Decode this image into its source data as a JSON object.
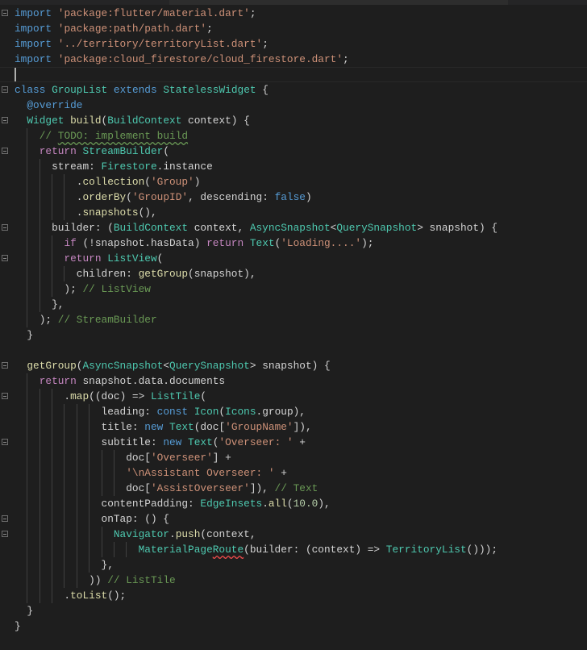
{
  "editor": {
    "language": "dart",
    "colors": {
      "background": "#1e1e1e",
      "keyword": "#569cd6",
      "control": "#c586c0",
      "string": "#ce9178",
      "type": "#4ec9b0",
      "function": "#dcdcaa",
      "comment": "#6a9955"
    },
    "lines": [
      {
        "fold": true,
        "tokens": [
          [
            "import",
            "kw"
          ],
          [
            " ",
            ""
          ],
          [
            "'package:flutter/material.dart'",
            "str"
          ],
          [
            ";",
            ""
          ]
        ]
      },
      {
        "tokens": [
          [
            "import",
            "kw"
          ],
          [
            " ",
            ""
          ],
          [
            "'package:path/path.dart'",
            "str"
          ],
          [
            ";",
            ""
          ]
        ]
      },
      {
        "tokens": [
          [
            "import",
            "kw"
          ],
          [
            " ",
            ""
          ],
          [
            "'../territory/territoryList.dart'",
            "str"
          ],
          [
            ";",
            ""
          ]
        ]
      },
      {
        "tokens": [
          [
            "import",
            "kw"
          ],
          [
            " ",
            ""
          ],
          [
            "'package:cloud_firestore/cloud_firestore.dart'",
            "str"
          ],
          [
            ";",
            ""
          ]
        ]
      },
      {
        "cursor": true,
        "tokens": []
      },
      {
        "fold": true,
        "tokens": [
          [
            "class",
            "kw"
          ],
          [
            " ",
            ""
          ],
          [
            "GroupList",
            "type"
          ],
          [
            " ",
            ""
          ],
          [
            "extends",
            "kw"
          ],
          [
            " ",
            ""
          ],
          [
            "StatelessWidget",
            "type"
          ],
          [
            " {",
            ""
          ]
        ]
      },
      {
        "tokens": [
          [
            "  ",
            ""
          ],
          [
            "@override",
            "meta"
          ]
        ]
      },
      {
        "fold": true,
        "tokens": [
          [
            "  ",
            ""
          ],
          [
            "Widget",
            "type"
          ],
          [
            " ",
            ""
          ],
          [
            "build",
            "fn"
          ],
          [
            "(",
            ""
          ],
          [
            "BuildContext",
            "type"
          ],
          [
            " context) {",
            ""
          ]
        ]
      },
      {
        "tokens": [
          [
            "    ",
            ""
          ],
          [
            "// ",
            "cm"
          ],
          [
            "TODO: implement build",
            "cm sq-g"
          ]
        ]
      },
      {
        "fold": true,
        "tokens": [
          [
            "    ",
            ""
          ],
          [
            "return",
            "ctrl"
          ],
          [
            " ",
            ""
          ],
          [
            "StreamBuilder",
            "type"
          ],
          [
            "(",
            ""
          ]
        ]
      },
      {
        "tokens": [
          [
            "      stream: ",
            ""
          ],
          [
            "Firestore",
            "type"
          ],
          [
            ".instance",
            ""
          ]
        ]
      },
      {
        "tokens": [
          [
            "          .",
            ""
          ],
          [
            "collection",
            "fn"
          ],
          [
            "(",
            ""
          ],
          [
            "'Group'",
            "str"
          ],
          [
            ")",
            ""
          ]
        ]
      },
      {
        "tokens": [
          [
            "          .",
            ""
          ],
          [
            "orderBy",
            "fn"
          ],
          [
            "(",
            ""
          ],
          [
            "'GroupID'",
            "str"
          ],
          [
            ", descending: ",
            ""
          ],
          [
            "false",
            "kw"
          ],
          [
            ")",
            ""
          ]
        ]
      },
      {
        "tokens": [
          [
            "          .",
            ""
          ],
          [
            "snapshots",
            "fn"
          ],
          [
            "(),",
            ""
          ]
        ]
      },
      {
        "fold": true,
        "tokens": [
          [
            "      builder: (",
            ""
          ],
          [
            "BuildContext",
            "type"
          ],
          [
            " context, ",
            ""
          ],
          [
            "AsyncSnapshot",
            "type"
          ],
          [
            "<",
            ""
          ],
          [
            "QuerySnapshot",
            "type"
          ],
          [
            "> snapshot) {",
            ""
          ]
        ]
      },
      {
        "tokens": [
          [
            "        ",
            ""
          ],
          [
            "if",
            "ctrl"
          ],
          [
            " (!snapshot.hasData) ",
            ""
          ],
          [
            "return",
            "ctrl"
          ],
          [
            " ",
            ""
          ],
          [
            "Text",
            "type"
          ],
          [
            "(",
            ""
          ],
          [
            "'Loading....'",
            "str"
          ],
          [
            ");",
            ""
          ]
        ]
      },
      {
        "fold": true,
        "tokens": [
          [
            "        ",
            ""
          ],
          [
            "return",
            "ctrl"
          ],
          [
            " ",
            ""
          ],
          [
            "ListView",
            "type"
          ],
          [
            "(",
            ""
          ]
        ]
      },
      {
        "tokens": [
          [
            "          children: ",
            ""
          ],
          [
            "getGroup",
            "fn"
          ],
          [
            "(snapshot),",
            ""
          ]
        ]
      },
      {
        "tokens": [
          [
            "        ); ",
            ""
          ],
          [
            "// ListView",
            "cm"
          ]
        ]
      },
      {
        "tokens": [
          [
            "      },",
            ""
          ]
        ]
      },
      {
        "tokens": [
          [
            "    ); ",
            ""
          ],
          [
            "// StreamBuilder",
            "cm"
          ]
        ]
      },
      {
        "tokens": [
          [
            "  }",
            ""
          ]
        ]
      },
      {
        "tokens": []
      },
      {
        "fold": true,
        "tokens": [
          [
            "  ",
            ""
          ],
          [
            "getGroup",
            "fn"
          ],
          [
            "(",
            ""
          ],
          [
            "AsyncSnapshot",
            "type"
          ],
          [
            "<",
            ""
          ],
          [
            "QuerySnapshot",
            "type"
          ],
          [
            "> snapshot) {",
            ""
          ]
        ]
      },
      {
        "tokens": [
          [
            "    ",
            ""
          ],
          [
            "return",
            "ctrl"
          ],
          [
            " snapshot.data.documents",
            ""
          ]
        ]
      },
      {
        "fold": true,
        "tokens": [
          [
            "        .",
            ""
          ],
          [
            "map",
            "fn"
          ],
          [
            "((doc) => ",
            ""
          ],
          [
            "ListTile",
            "type"
          ],
          [
            "(",
            ""
          ]
        ]
      },
      {
        "tokens": [
          [
            "              leading: ",
            ""
          ],
          [
            "const",
            "kw"
          ],
          [
            " ",
            ""
          ],
          [
            "Icon",
            "type"
          ],
          [
            "(",
            ""
          ],
          [
            "Icons",
            "type"
          ],
          [
            ".group),",
            ""
          ]
        ]
      },
      {
        "tokens": [
          [
            "              title: ",
            ""
          ],
          [
            "new",
            "kw"
          ],
          [
            " ",
            ""
          ],
          [
            "Text",
            "type"
          ],
          [
            "(doc[",
            ""
          ],
          [
            "'GroupName'",
            "str"
          ],
          [
            "]),",
            ""
          ]
        ]
      },
      {
        "fold": true,
        "tokens": [
          [
            "              subtitle: ",
            ""
          ],
          [
            "new",
            "kw"
          ],
          [
            " ",
            ""
          ],
          [
            "Text",
            "type"
          ],
          [
            "(",
            ""
          ],
          [
            "'Overseer: '",
            "str"
          ],
          [
            " +",
            ""
          ]
        ]
      },
      {
        "tokens": [
          [
            "                  doc[",
            ""
          ],
          [
            "'Overseer'",
            "str"
          ],
          [
            "] +",
            ""
          ]
        ]
      },
      {
        "tokens": [
          [
            "                  ",
            ""
          ],
          [
            "'\\nAssistant Overseer: '",
            "str"
          ],
          [
            " +",
            ""
          ]
        ]
      },
      {
        "tokens": [
          [
            "                  doc[",
            ""
          ],
          [
            "'AssistOverseer'",
            "str"
          ],
          [
            "]), ",
            ""
          ],
          [
            "// Text",
            "cm"
          ]
        ]
      },
      {
        "tokens": [
          [
            "              contentPadding: ",
            ""
          ],
          [
            "EdgeInsets",
            "type"
          ],
          [
            ".",
            ""
          ],
          [
            "all",
            "fn"
          ],
          [
            "(",
            ""
          ],
          [
            "10.0",
            "num"
          ],
          [
            "),",
            ""
          ]
        ]
      },
      {
        "fold": true,
        "tokens": [
          [
            "              onTap: () {",
            ""
          ]
        ]
      },
      {
        "fold": true,
        "tokens": [
          [
            "                ",
            ""
          ],
          [
            "Navigator",
            "type"
          ],
          [
            ".",
            ""
          ],
          [
            "push",
            "fn"
          ],
          [
            "(context,",
            ""
          ]
        ]
      },
      {
        "tokens": [
          [
            "                    ",
            ""
          ],
          [
            "MaterialPage",
            "type"
          ],
          [
            "Route",
            "type sq-r"
          ],
          [
            "(builder: (context) => ",
            ""
          ],
          [
            "TerritoryList",
            "type"
          ],
          [
            "()));",
            ""
          ]
        ]
      },
      {
        "tokens": [
          [
            "              },",
            ""
          ]
        ]
      },
      {
        "tokens": [
          [
            "            )) ",
            ""
          ],
          [
            "// ListTile",
            "cm"
          ]
        ]
      },
      {
        "tokens": [
          [
            "        .",
            ""
          ],
          [
            "toList",
            "fn"
          ],
          [
            "();",
            ""
          ]
        ]
      },
      {
        "tokens": [
          [
            "  }",
            ""
          ]
        ]
      },
      {
        "tokens": [
          [
            "}",
            ""
          ]
        ]
      }
    ]
  }
}
